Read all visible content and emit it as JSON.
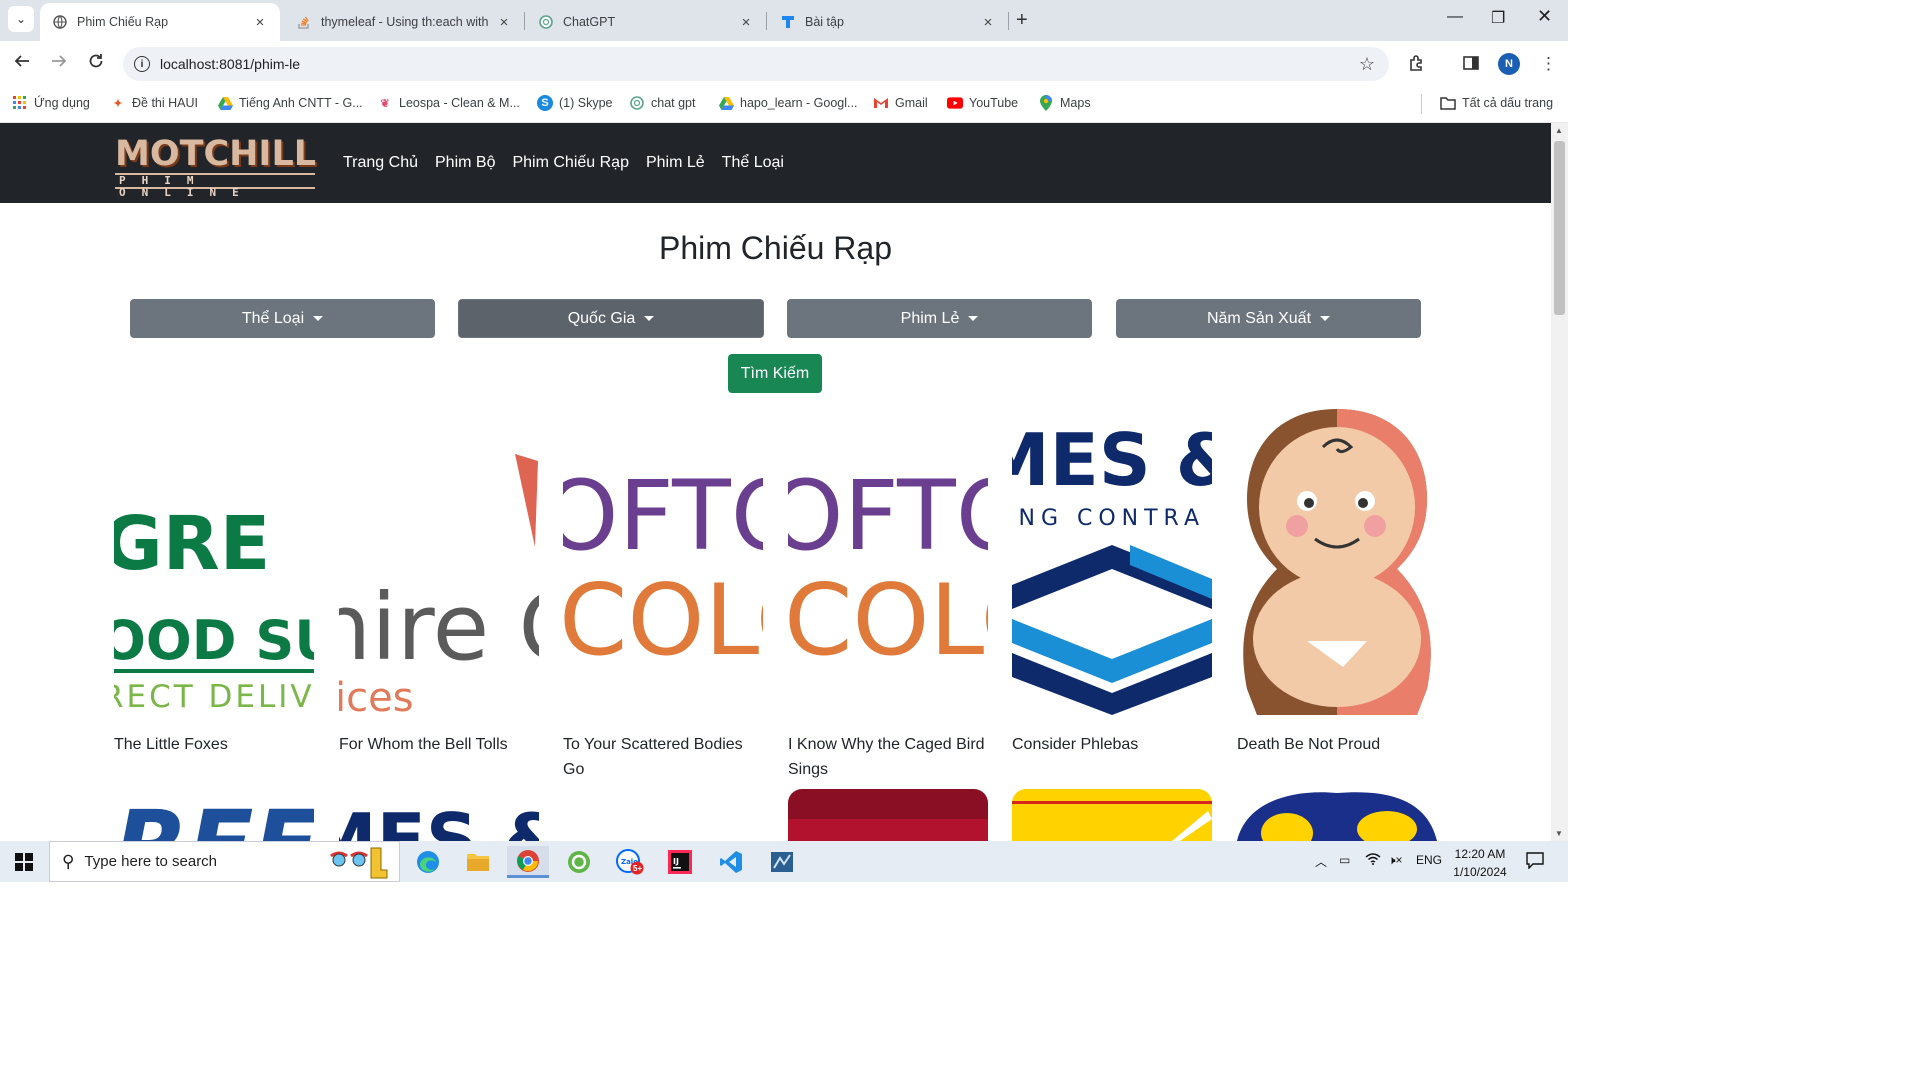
{
  "browser": {
    "tabs": [
      {
        "title": "Phim Chiếu Rạp",
        "active": true
      },
      {
        "title": "thymeleaf - Using th:each with",
        "active": false
      },
      {
        "title": "ChatGPT",
        "active": false
      },
      {
        "title": "Bài tập",
        "active": false
      }
    ],
    "url": "localhost:8081/phim-le",
    "profile_initial": "N",
    "bookmarks": [
      "Ứng dụng",
      "Đề thi HAUI",
      "Tiếng Anh CNTT - G...",
      "Leospa - Clean & M...",
      "(1) Skype",
      "chat gpt",
      "hapo_learn - Googl...",
      "Gmail",
      "YouTube",
      "Maps"
    ],
    "all_bookmarks": "Tất cả dấu trang"
  },
  "site": {
    "logo_word": "MOTCHILL",
    "logo_sub": "PHIM ONLINE",
    "menu": [
      "Trang Chủ",
      "Phim Bộ",
      "Phim Chiếu Rạp",
      "Phim Lẻ",
      "Thể Loại"
    ],
    "page_title": "Phim Chiếu Rạp",
    "filters": [
      "Thể Loại",
      "Quốc Gia",
      "Phim Lẻ",
      "Năm Sản Xuất"
    ],
    "search_label": "Tìm Kiếm"
  },
  "movies": [
    {
      "title": "The Little Foxes",
      "poster_text": [
        "GRE",
        "OOD SU",
        "RECT DELIV"
      ]
    },
    {
      "title": "For Whom the Bell Tolls",
      "poster_text": [
        "nire C",
        "ices"
      ]
    },
    {
      "title": "To Your Scattered Bodies Go",
      "poster_text": [
        "OFTO",
        "COLO"
      ]
    },
    {
      "title": "I Know Why the Caged Bird Sings",
      "poster_text": [
        "OFTO",
        "COLO"
      ]
    },
    {
      "title": "Consider Phlebas",
      "poster_text": [
        "MES & SO",
        "ING CONTRA"
      ]
    },
    {
      "title": "Death Be Not Proud",
      "poster_text": []
    }
  ],
  "movies_row2_poster_text": [
    "REE",
    "MES & SO"
  ],
  "taskbar": {
    "search_placeholder": "Type here to search",
    "language": "ENG",
    "time": "12:20 AM",
    "date": "1/10/2024",
    "zalo_badge": "5+"
  },
  "colors": {
    "navbar": "#212529",
    "dropdown": "#6c757d",
    "search_button": "#198754",
    "green_logo": "#0b7a45",
    "purple": "#6b3f8f",
    "orange": "#e07a3a",
    "navy": "#0f2a6b"
  }
}
